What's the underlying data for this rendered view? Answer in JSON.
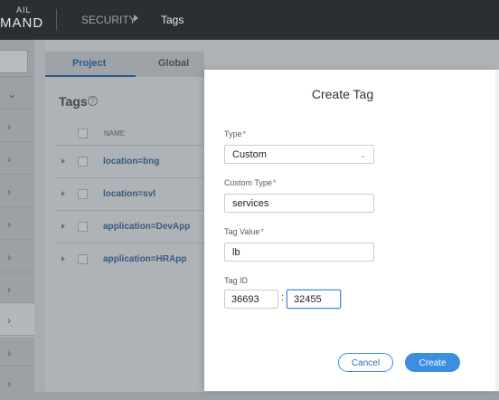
{
  "header": {
    "logo_top": "AIL",
    "logo_bottom": "MAND",
    "breadcrumb": [
      "SECURITY",
      "Tags"
    ]
  },
  "tabs": [
    {
      "label": "Project",
      "active": true
    },
    {
      "label": "Global",
      "active": false
    }
  ],
  "tags_panel": {
    "title": "Tags",
    "column_name": "NAME",
    "rows": [
      "location=bng",
      "location=svl",
      "application=DevApp",
      "application=HRApp"
    ]
  },
  "modal": {
    "title": "Create Tag",
    "type_label": "Type",
    "type_value": "Custom",
    "custom_type_label": "Custom Type",
    "custom_type_value": "services",
    "tag_value_label": "Tag Value",
    "tag_value_value": "lb",
    "tag_id_label": "Tag ID",
    "tag_id_part1": "36693",
    "tag_id_part2": "32455",
    "cancel_label": "Cancel",
    "create_label": "Create"
  },
  "colors": {
    "accent": "#3b8ee0",
    "required": "#d9534f",
    "topbar": "#2b2f33"
  }
}
